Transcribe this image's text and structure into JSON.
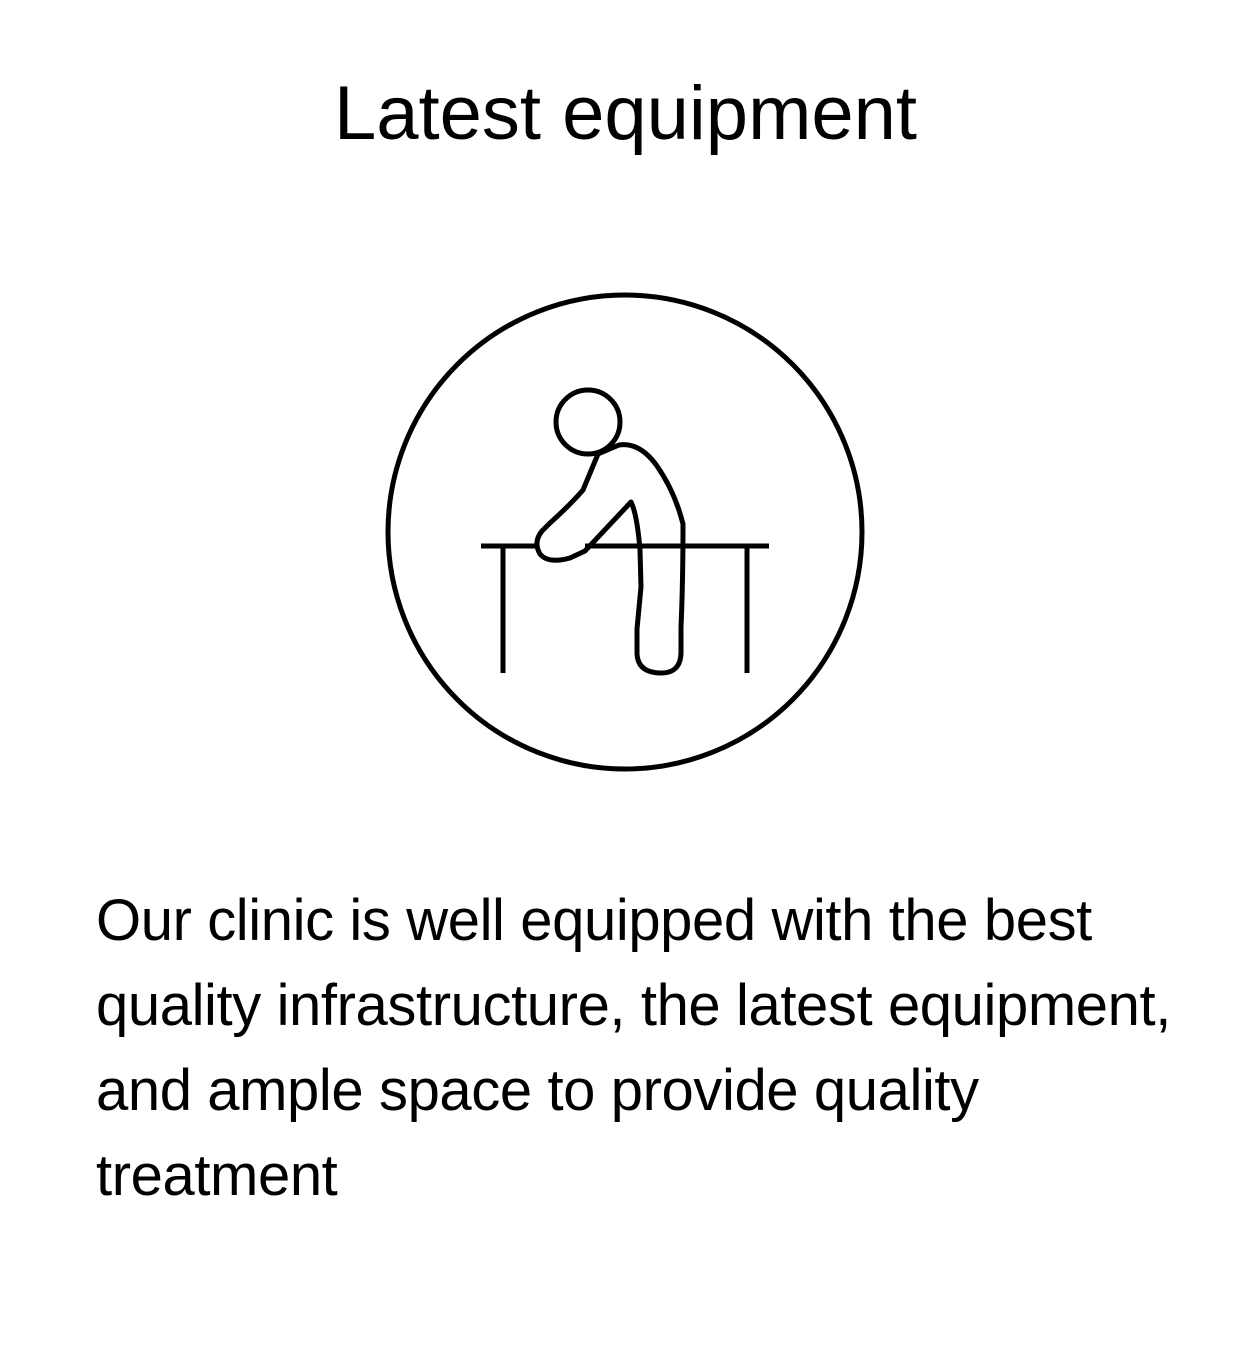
{
  "feature": {
    "title": "Latest equipment",
    "icon": "person-leaning-on-table-icon",
    "description": "Our clinic is well equipped with the best quality infrastructure, the latest equipment, and ample space to provide quality treatment"
  },
  "colors": {
    "background": "#ffffff",
    "text": "#000000",
    "icon_stroke": "#000000"
  }
}
